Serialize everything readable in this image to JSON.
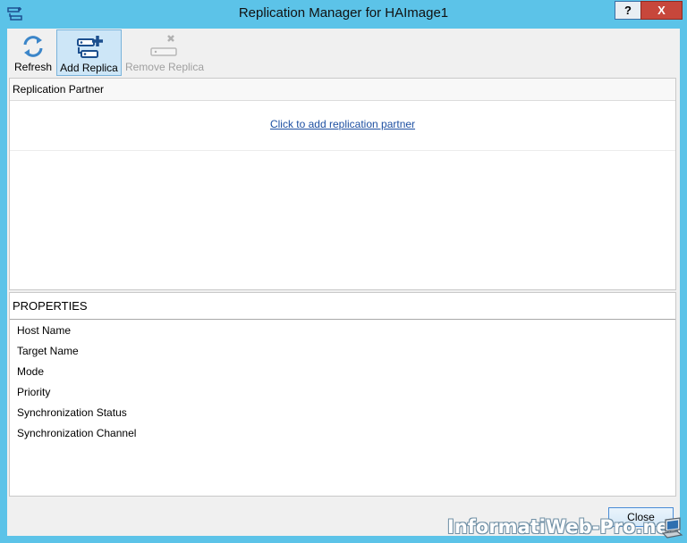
{
  "window": {
    "title": "Replication Manager for HAImage1",
    "help_label": "?",
    "close_glyph": "X"
  },
  "ribbon": {
    "refresh_label": "Refresh",
    "add_replica_label": "Add Replica",
    "remove_replica_label": "Remove Replica",
    "icons": {
      "refresh": "refresh-icon",
      "add_replica": "add-replica-icon",
      "remove_replica": "remove-replica-icon"
    }
  },
  "partners": {
    "header": "Replication Partner",
    "add_link": "Click to add replication partner"
  },
  "properties": {
    "header": "PROPERTIES",
    "items": [
      "Host Name",
      "Target Name",
      "Mode",
      "Priority",
      "Synchronization Status",
      "Synchronization Channel"
    ]
  },
  "footer": {
    "close_label": "Close"
  },
  "watermark": {
    "text": "InformatiWeb-Pro.net"
  },
  "colors": {
    "title_bar": "#5cc3e8",
    "link": "#1e50a2",
    "selected_button": "#cde6f7",
    "close_button_red": "#c7473b"
  }
}
